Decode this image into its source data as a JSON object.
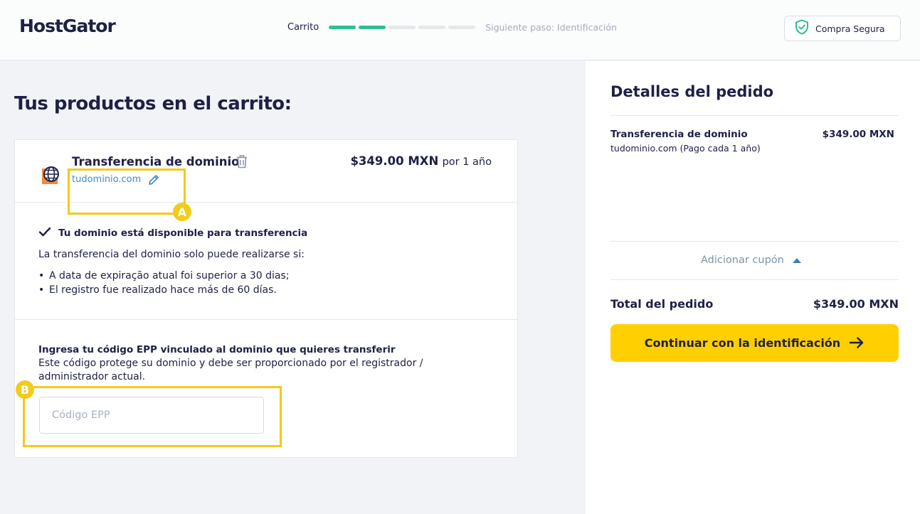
{
  "header": {
    "logo": "HostGator",
    "progress": {
      "current_label": "Carrito",
      "steps_total": 5,
      "steps_completed": 2,
      "next_label": "Siguiente paso: Identificación"
    },
    "secure_label": "Compra Segura"
  },
  "cart": {
    "title": "Tus productos en el carrito:",
    "product": {
      "name": "Transferencia de dominio",
      "domain": "tudominio.com",
      "price": "$349.00 MXN",
      "period": "por 1 año",
      "icon": "globe-icon"
    },
    "availability": "Tu dominio está disponible para transferencia",
    "conditions_intro": "La transferencia del dominio solo puede realizarse si:",
    "conditions": [
      "A data de expiração atual foi superior a 30 dias;",
      "El registro fue realizado hace más de 60 días."
    ],
    "epp": {
      "title": "Ingresa tu código EPP vinculado al dominio que quieres transferir",
      "description": "Este código protege su dominio y debe ser proporcionado por el registrador / administrador actual.",
      "placeholder": "Código EPP",
      "value": ""
    }
  },
  "annotations": {
    "a": "A",
    "b": "B",
    "color": "#f2cb1d"
  },
  "order": {
    "title": "Detalles del pedido",
    "item_name": "Transferencia de dominio",
    "item_price": "$349.00 MXN",
    "item_sub": "tudominio.com (Pago cada 1 año)",
    "coupon_label": "Adicionar cupón",
    "total_label": "Total del pedido",
    "total_value": "$349.00 MXN",
    "cta_label": "Continuar con la identificación"
  },
  "colors": {
    "brand_navy": "#1e2046",
    "progress_green": "#2fc08d",
    "cta_yellow": "#ffcf00",
    "link_blue": "#3d8cd1",
    "shield_green": "#2fc08d"
  }
}
